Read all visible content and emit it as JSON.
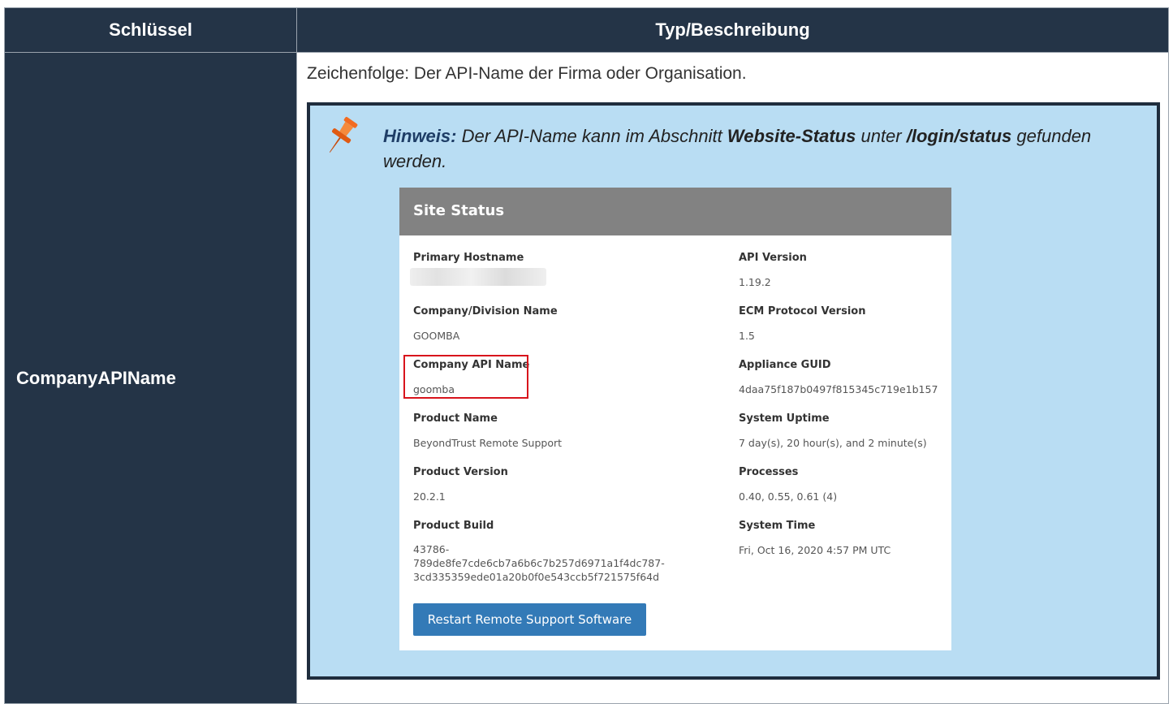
{
  "table": {
    "headers": {
      "key": "Schlüssel",
      "description": "Typ/Beschreibung"
    },
    "row": {
      "key": "CompanyAPIName",
      "description": "Zeichenfolge: Der API-Name der Firma oder Organisation."
    }
  },
  "note": {
    "label": "Hinweis:",
    "text_1": " Der API-Name kann im Abschnitt ",
    "bold_1": "Website-Status",
    "text_2": " unter ",
    "bold_2": "/login/status",
    "text_3": " gefunden werden.",
    "icon": "pushpin-icon"
  },
  "site_status": {
    "title": "Site Status",
    "left_items": [
      {
        "label": "Primary Hostname",
        "value": ""
      },
      {
        "label": "Company/Division Name",
        "value": "GOOMBA"
      },
      {
        "label": "Company API Name",
        "value": "goomba"
      },
      {
        "label": "Product Name",
        "value": "BeyondTrust Remote Support"
      },
      {
        "label": "Product Version",
        "value": "20.2.1"
      },
      {
        "label": "Product Build",
        "value_lines": [
          "43786-",
          "789de8fe7cde6cb7a6b6c7b257d6971a1f4dc787-",
          "3cd335359ede01a20b0f0e543ccb5f721575f64d"
        ]
      }
    ],
    "right_items": [
      {
        "label": "API Version",
        "value": "1.19.2"
      },
      {
        "label": "ECM Protocol Version",
        "value": "1.5"
      },
      {
        "label": "Appliance GUID",
        "value": "4daa75f187b0497f815345c719e1b157"
      },
      {
        "label": "System Uptime",
        "value": "7 day(s), 20 hour(s), and 2 minute(s)"
      },
      {
        "label": "Processes",
        "value": "0.40, 0.55, 0.61 (4)"
      },
      {
        "label": "System Time",
        "value": "Fri, Oct 16, 2020 4:57 PM UTC"
      }
    ],
    "restart_button": "Restart Remote Support Software",
    "colors": {
      "header": "#828282",
      "button": "#337ab7",
      "highlight": "#d8141c"
    }
  },
  "colors": {
    "table_dark": "#243447",
    "note_bg": "#b9ddf3",
    "pin": "#f26b21"
  }
}
